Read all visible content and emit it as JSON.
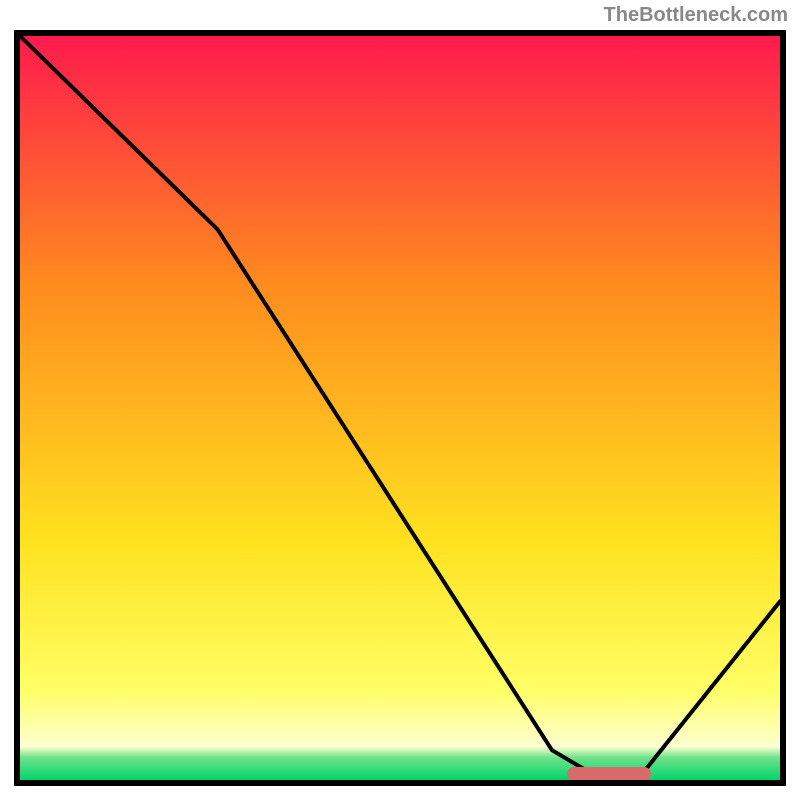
{
  "watermark": "TheBottleneck.com",
  "chart_data": {
    "type": "line",
    "title": "",
    "xlabel": "",
    "ylabel": "",
    "xlim": [
      0,
      100
    ],
    "ylim": [
      0,
      100
    ],
    "series": [
      {
        "name": "curve",
        "points": [
          {
            "x": 0,
            "y": 100
          },
          {
            "x": 26,
            "y": 74
          },
          {
            "x": 70,
            "y": 4
          },
          {
            "x": 75,
            "y": 1
          },
          {
            "x": 82,
            "y": 1
          },
          {
            "x": 100,
            "y": 24
          }
        ]
      }
    ],
    "marker": {
      "x_start": 72,
      "x_end": 83,
      "y": 0.5
    },
    "gradient_stops": [
      {
        "offset": 0,
        "color": "#ff1a4d"
      },
      {
        "offset": 0.33,
        "color": "#ff8a1f"
      },
      {
        "offset": 0.68,
        "color": "#ffe21f"
      },
      {
        "offset": 0.88,
        "color": "#ffff66"
      },
      {
        "offset": 0.955,
        "color": "#fdffd0"
      },
      {
        "offset": 0.97,
        "color": "#6fe28a"
      },
      {
        "offset": 1.0,
        "color": "#00d66a"
      }
    ]
  }
}
